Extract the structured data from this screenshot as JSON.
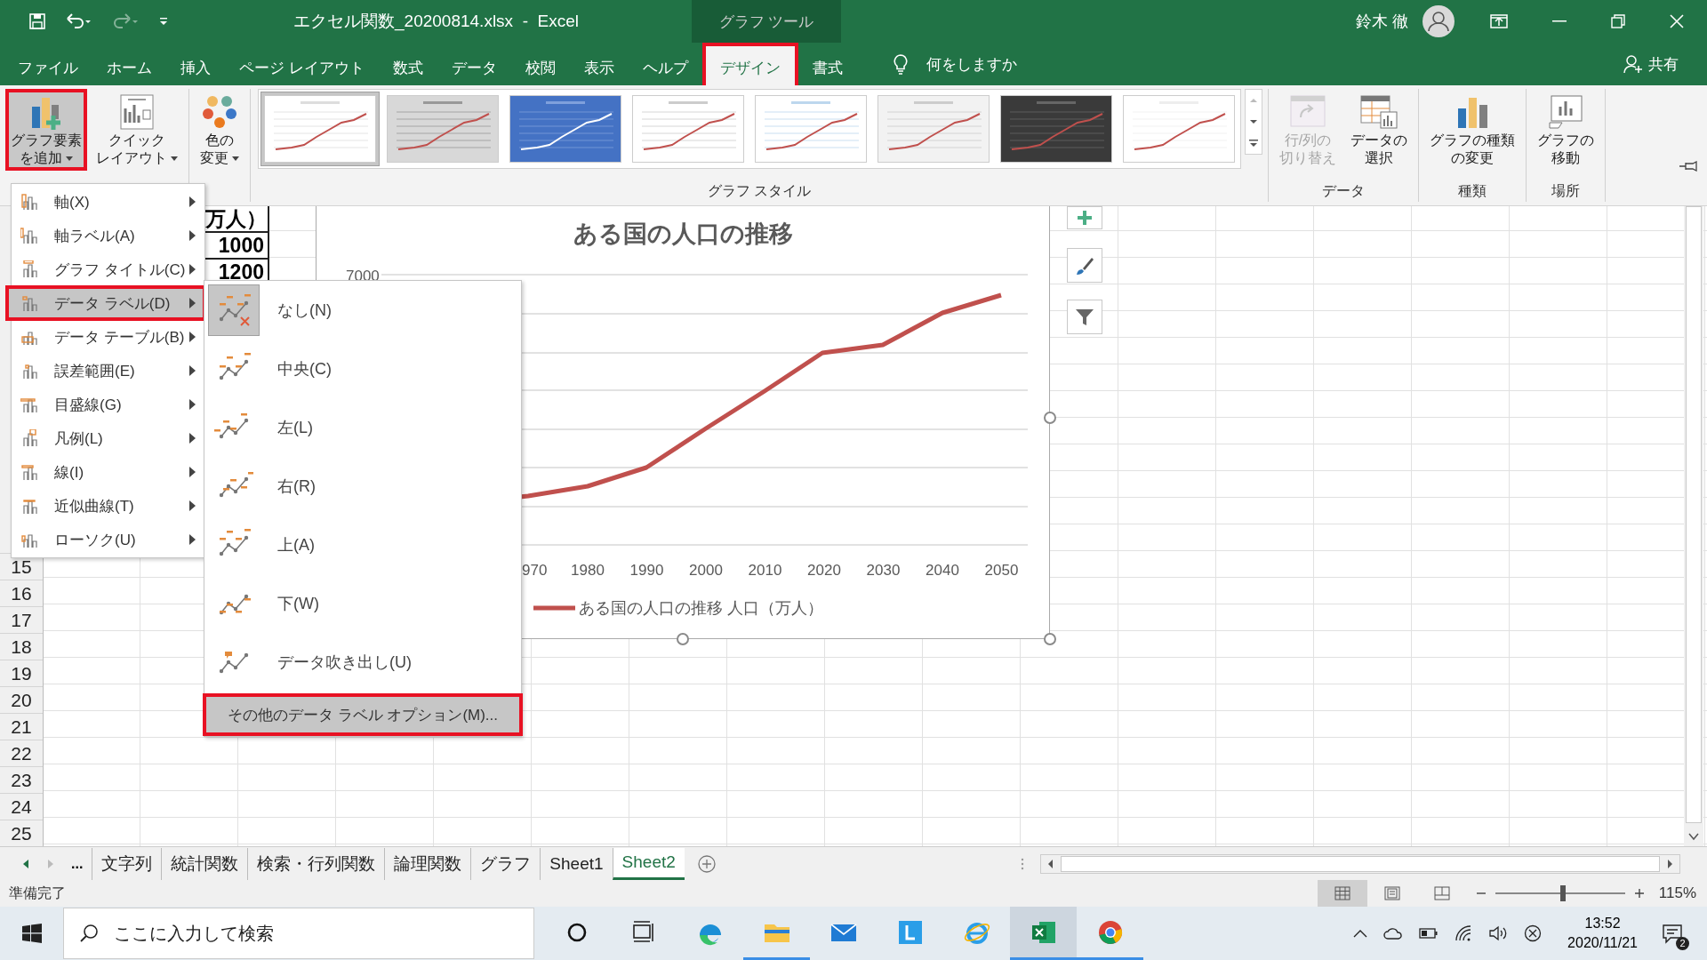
{
  "title_bar": {
    "title": "エクセル関数_20200814.xlsx  -  Excel",
    "context_group": "グラフ ツール",
    "user": "鈴木 徹"
  },
  "ribbon_tabs": [
    {
      "label": "ファイル",
      "selected": false,
      "highlighted": false
    },
    {
      "label": "ホーム",
      "selected": false,
      "highlighted": false
    },
    {
      "label": "挿入",
      "selected": false,
      "highlighted": false
    },
    {
      "label": "ページ レイアウト",
      "selected": false,
      "highlighted": false
    },
    {
      "label": "数式",
      "selected": false,
      "highlighted": false
    },
    {
      "label": "データ",
      "selected": false,
      "highlighted": false
    },
    {
      "label": "校閲",
      "selected": false,
      "highlighted": false
    },
    {
      "label": "表示",
      "selected": false,
      "highlighted": false
    },
    {
      "label": "ヘルプ",
      "selected": false,
      "highlighted": false
    },
    {
      "label": "デザイン",
      "selected": true,
      "highlighted": true
    },
    {
      "label": "書式",
      "selected": false,
      "highlighted": false
    }
  ],
  "tell_me": "何をしますか",
  "share": "共有",
  "ribbon_groups": [
    {
      "kind": "buttons",
      "buttons": [
        {
          "kind": "add-element",
          "label_lines": [
            "グラフ要素",
            "を追加"
          ],
          "dropdown": true,
          "highlighted": true,
          "disabled": false
        },
        {
          "kind": "quick-layout",
          "label_lines": [
            "クイック",
            "レイアウト"
          ],
          "dropdown": true,
          "highlighted": false,
          "disabled": false
        }
      ]
    },
    {
      "kind": "buttons",
      "buttons": [
        {
          "kind": "colors",
          "label_lines": [
            "色の",
            "変更"
          ],
          "dropdown": true,
          "highlighted": false,
          "disabled": false
        }
      ]
    },
    {
      "kind": "gallery",
      "label": "グラフ スタイル",
      "styles": [
        {
          "kind": "plain",
          "selected": true
        },
        {
          "kind": "shaded",
          "selected": false
        },
        {
          "kind": "blue",
          "selected": false
        },
        {
          "kind": "columns",
          "selected": false
        },
        {
          "kind": "banded",
          "selected": false
        },
        {
          "kind": "hatched",
          "selected": false
        },
        {
          "kind": "dark",
          "selected": false
        },
        {
          "kind": "markers",
          "selected": false
        }
      ]
    },
    {
      "kind": "buttons",
      "label": "データ",
      "buttons": [
        {
          "kind": "switch",
          "label_lines": [
            "行/列の",
            "切り替え"
          ],
          "dropdown": false,
          "highlighted": false,
          "disabled": true
        },
        {
          "kind": "select-data",
          "label_lines": [
            "データの",
            "選択"
          ],
          "dropdown": false,
          "highlighted": false,
          "disabled": false
        }
      ]
    },
    {
      "kind": "buttons",
      "label": "種類",
      "buttons": [
        {
          "kind": "change-type",
          "label_lines": [
            "グラフの種類",
            "の変更"
          ],
          "dropdown": false,
          "highlighted": false,
          "disabled": false
        }
      ]
    },
    {
      "kind": "buttons",
      "label": "場所",
      "buttons": [
        {
          "kind": "move",
          "label_lines": [
            "グラフの",
            "移動"
          ],
          "dropdown": false,
          "highlighted": false,
          "disabled": false
        }
      ]
    }
  ],
  "cells": [
    {
      "text": "万人）"
    },
    {
      "text": "1000"
    },
    {
      "text": "1200"
    }
  ],
  "row_headers": [
    "15",
    "16",
    "17",
    "18",
    "19",
    "20",
    "21",
    "22",
    "23",
    "24",
    "25"
  ],
  "chart": {
    "selected": true,
    "title": "ある国の人口の推移",
    "y_tick": "7000",
    "x_labels": [
      "970",
      "1980",
      "1990",
      "2000",
      "2010",
      "2020",
      "2030",
      "2040",
      "2050"
    ],
    "legend": "ある国の人口の推移 人口（万人）"
  },
  "menu": {
    "items": [
      {
        "label": "軸(X)",
        "selected": false
      },
      {
        "label": "軸ラベル(A)",
        "selected": false
      },
      {
        "label": "グラフ タイトル(C)",
        "selected": false
      },
      {
        "label": "データ ラベル(D)",
        "selected": true
      },
      {
        "label": "データ テーブル(B)",
        "selected": false
      },
      {
        "label": "誤差範囲(E)",
        "selected": false
      },
      {
        "label": "目盛線(G)",
        "selected": false
      },
      {
        "label": "凡例(L)",
        "selected": false
      },
      {
        "label": "線(I)",
        "selected": false
      },
      {
        "label": "近似曲線(T)",
        "selected": false
      },
      {
        "label": "ローソク(U)",
        "selected": false
      }
    ]
  },
  "submenu": {
    "items": [
      {
        "kind": "none",
        "label": "なし(N)",
        "selected": true
      },
      {
        "kind": "center",
        "label": "中央(C)",
        "selected": false
      },
      {
        "kind": "left",
        "label": "左(L)",
        "selected": false
      },
      {
        "kind": "right",
        "label": "右(R)",
        "selected": false
      },
      {
        "kind": "above",
        "label": "上(A)",
        "selected": false
      },
      {
        "kind": "below",
        "label": "下(W)",
        "selected": false
      },
      {
        "kind": "callout",
        "label": "データ吹き出し(U)",
        "selected": false
      }
    ],
    "more": {
      "label": "その他のデータ ラベル オプション(M)...",
      "highlighted": true
    }
  },
  "sheet_tabs": {
    "overflow": "...",
    "tabs": [
      {
        "label": "文字列",
        "selected": false
      },
      {
        "label": "統計関数",
        "selected": false
      },
      {
        "label": "検索・行列関数",
        "selected": false
      },
      {
        "label": "論理関数",
        "selected": false
      },
      {
        "label": "グラフ",
        "selected": false
      },
      {
        "label": "Sheet1",
        "selected": false
      },
      {
        "label": "Sheet2",
        "selected": true
      }
    ]
  },
  "status_bar": {
    "text": "準備完了",
    "views": [
      {
        "kind": "normal",
        "selected": true
      },
      {
        "kind": "page-layout",
        "selected": false
      },
      {
        "kind": "page-break",
        "selected": false
      }
    ],
    "zoom": {
      "level": 0.52,
      "reading": "115%"
    }
  },
  "taskbar": {
    "search_placeholder": "ここに入力して検索",
    "apps": [
      {
        "kind": "cortana",
        "running": false,
        "focused": false
      },
      {
        "kind": "task-view",
        "running": false,
        "focused": false
      },
      {
        "kind": "edge",
        "running": false,
        "focused": false
      },
      {
        "kind": "explorer",
        "running": true,
        "focused": false
      },
      {
        "kind": "mail",
        "running": false,
        "focused": false
      },
      {
        "kind": "l-app",
        "running": false,
        "focused": false
      },
      {
        "kind": "ie",
        "running": false,
        "focused": false
      },
      {
        "kind": "excel",
        "running": true,
        "focused": true
      },
      {
        "kind": "chrome",
        "running": true,
        "focused": false
      }
    ],
    "time": "13:52",
    "date": "2020/11/21",
    "notifications": "2"
  }
}
